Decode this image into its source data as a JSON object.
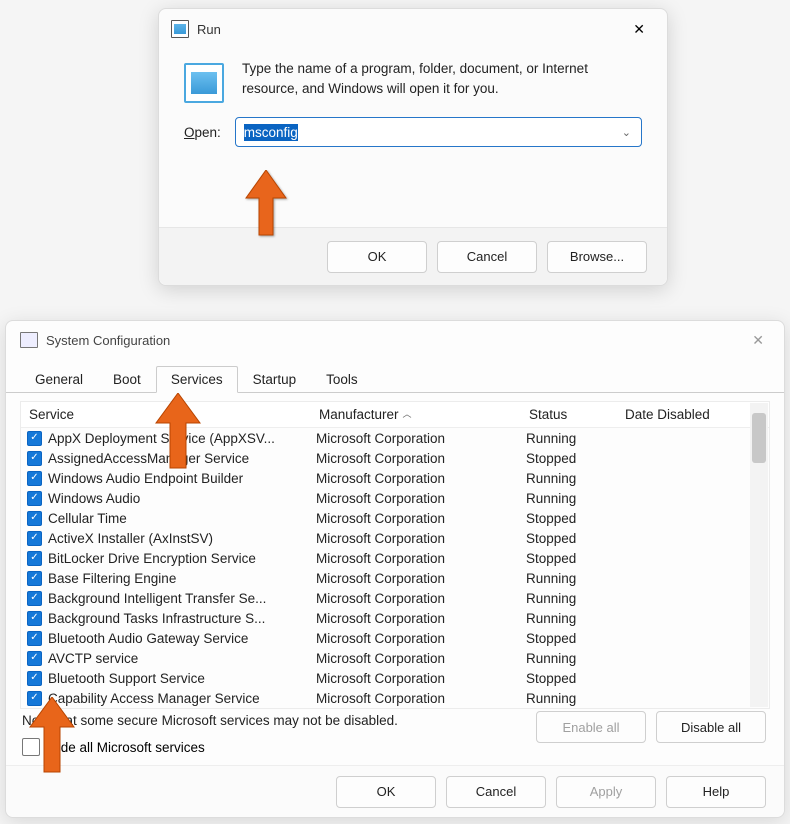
{
  "run": {
    "title": "Run",
    "description": "Type the name of a program, folder, document, or Internet resource, and Windows will open it for you.",
    "open_label": "Open:",
    "open_value": "msconfig",
    "buttons": {
      "ok": "OK",
      "cancel": "Cancel",
      "browse": "Browse..."
    }
  },
  "sysconfig": {
    "title": "System Configuration",
    "tabs": {
      "general": "General",
      "boot": "Boot",
      "services": "Services",
      "startup": "Startup",
      "tools": "Tools"
    },
    "columns": {
      "service": "Service",
      "manufacturer": "Manufacturer",
      "status": "Status",
      "date_disabled": "Date Disabled"
    },
    "note": "Note that some secure Microsoft services may not be disabled.",
    "hide_label": "Hide all Microsoft services",
    "buttons": {
      "enable_all": "Enable all",
      "disable_all": "Disable all",
      "ok": "OK",
      "cancel": "Cancel",
      "apply": "Apply",
      "help": "Help"
    },
    "services": [
      {
        "name": "AppX Deployment Service (AppXSV...",
        "mfr": "Microsoft Corporation",
        "status": "Running",
        "checked": true
      },
      {
        "name": "AssignedAccessManager Service",
        "mfr": "Microsoft Corporation",
        "status": "Stopped",
        "checked": true
      },
      {
        "name": "Windows Audio Endpoint Builder",
        "mfr": "Microsoft Corporation",
        "status": "Running",
        "checked": true
      },
      {
        "name": "Windows Audio",
        "mfr": "Microsoft Corporation",
        "status": "Running",
        "checked": true
      },
      {
        "name": "Cellular Time",
        "mfr": "Microsoft Corporation",
        "status": "Stopped",
        "checked": true
      },
      {
        "name": "ActiveX Installer (AxInstSV)",
        "mfr": "Microsoft Corporation",
        "status": "Stopped",
        "checked": true
      },
      {
        "name": "BitLocker Drive Encryption Service",
        "mfr": "Microsoft Corporation",
        "status": "Stopped",
        "checked": true
      },
      {
        "name": "Base Filtering Engine",
        "mfr": "Microsoft Corporation",
        "status": "Running",
        "checked": true
      },
      {
        "name": "Background Intelligent Transfer Se...",
        "mfr": "Microsoft Corporation",
        "status": "Running",
        "checked": true
      },
      {
        "name": "Background Tasks Infrastructure S...",
        "mfr": "Microsoft Corporation",
        "status": "Running",
        "checked": true
      },
      {
        "name": "Bluetooth Audio Gateway Service",
        "mfr": "Microsoft Corporation",
        "status": "Stopped",
        "checked": true
      },
      {
        "name": "AVCTP service",
        "mfr": "Microsoft Corporation",
        "status": "Running",
        "checked": true
      },
      {
        "name": "Bluetooth Support Service",
        "mfr": "Microsoft Corporation",
        "status": "Stopped",
        "checked": true
      },
      {
        "name": "Capability Access Manager Service",
        "mfr": "Microsoft Corporation",
        "status": "Running",
        "checked": true
      }
    ]
  },
  "annotations": {
    "arrow1": "points to msconfig text",
    "arrow2": "points to Services tab",
    "arrow3": "points to a checkbox"
  }
}
